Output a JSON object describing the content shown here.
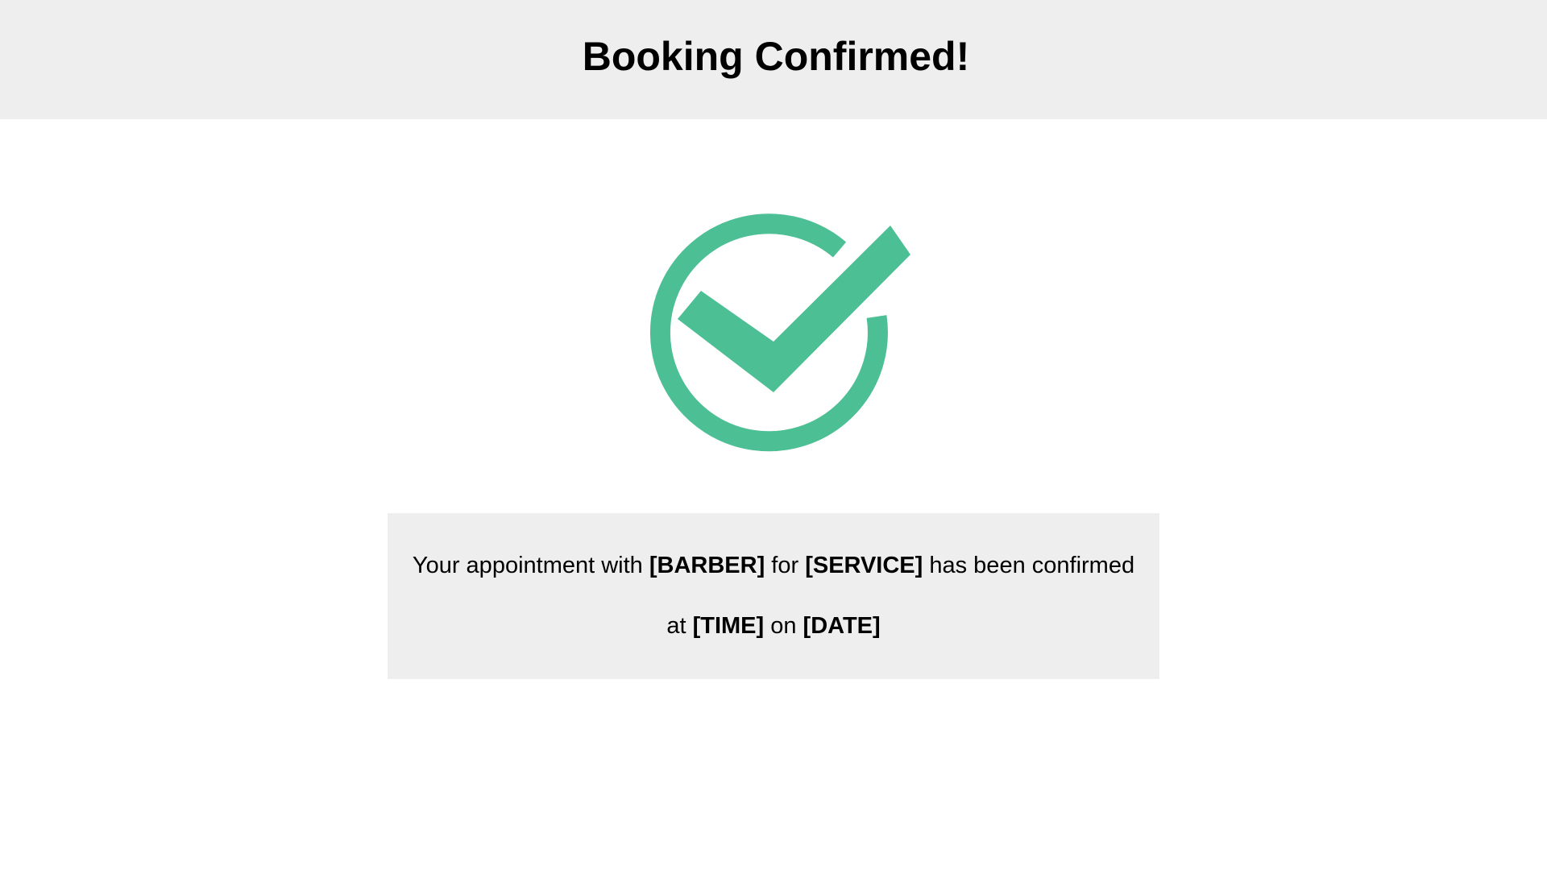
{
  "header": {
    "title": "Booking Confirmed!"
  },
  "icon": {
    "name": "check-circle-icon",
    "color": "#4dbf94"
  },
  "message": {
    "line1_prefix": "Your appointment with ",
    "barber": "[BARBER]",
    "line1_mid": " for ",
    "service": "[SERVICE]",
    "line1_suffix": " has been confirmed",
    "line2_prefix": "at ",
    "time": "[TIME]",
    "line2_mid": " on ",
    "date": "[DATE]"
  },
  "colors": {
    "panel_background": "#eeeeee",
    "page_background": "#ffffff"
  }
}
